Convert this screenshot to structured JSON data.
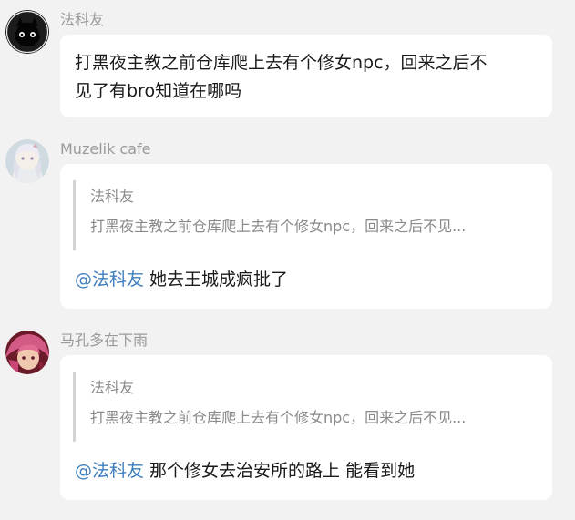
{
  "messages": [
    {
      "sender": "法科友",
      "avatar_icon": "black-cat-avatar-icon",
      "text_line1": "打黑夜主教之前仓库爬上去有个修女npc，回来之后不",
      "text_line2": "见了有bro知道在哪吗"
    },
    {
      "sender": "Muzelik cafe",
      "avatar_icon": "anime-girl-avatar-icon",
      "quote_author": "法科友",
      "quote_text": "打黑夜主教之前仓库爬上去有个修女npc，回来之后不见...",
      "mention": "@法科友",
      "reply": " 她去王城成疯批了"
    },
    {
      "sender": "马孔多在下雨",
      "avatar_icon": "pink-hair-avatar-icon",
      "quote_author": "法科友",
      "quote_text": "打黑夜主教之前仓库爬上去有个修女npc，回来之后不见...",
      "mention": "@法科友",
      "reply": " 那个修女去治安所的路上 能看到她"
    }
  ],
  "colors": {
    "background": "#f2f2f2",
    "bubble": "#ffffff",
    "mention": "#3f7fbf",
    "sender": "#9a9a9a"
  }
}
